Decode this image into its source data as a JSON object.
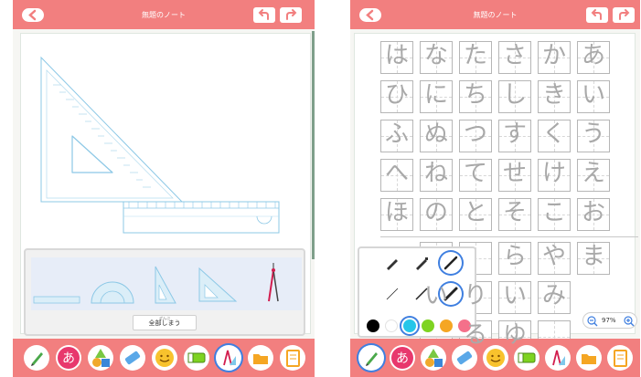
{
  "left_screen": {
    "header": {
      "title": "無題のノート"
    },
    "drawer": {
      "put_away_ruby": "ぜんぶ",
      "put_away_label": "全部しまう"
    }
  },
  "right_screen": {
    "header": {
      "title": "無題のノート"
    },
    "practice_sheet": {
      "rows_top": [
        [
          "は",
          "な",
          "た",
          "さ",
          "か",
          "あ"
        ],
        [
          "ひ",
          "に",
          "ち",
          "し",
          "き",
          "い"
        ],
        [
          "ふ",
          "ぬ",
          "つ",
          "す",
          "く",
          "う"
        ],
        [
          "へ",
          "ね",
          "て",
          "せ",
          "け",
          "え"
        ],
        [
          "ほ",
          "の",
          "と",
          "そ",
          "こ",
          "お"
        ]
      ],
      "rows_bottom": [
        [
          "",
          "",
          "ら",
          "や",
          "ま"
        ],
        [
          "い",
          "り",
          "い",
          "み"
        ],
        [
          "",
          "る",
          "ゆ",
          ""
        ]
      ]
    },
    "zoom": {
      "level": "97%"
    }
  },
  "colors": {
    "accent": "#f27f7f",
    "selection": "#3f7fe0",
    "swatches": [
      "#000000",
      "#ffffff",
      "#26c6e9",
      "#7ed321",
      "#f5a623",
      "#f4708a"
    ]
  },
  "toolbar_icons": [
    "pencil-icon",
    "hiragana-a-icon",
    "shapes-icon",
    "eraser-icon",
    "smiley-icon",
    "green-marker-icon",
    "ruler-compass-icon",
    "folder-icon",
    "notebook-icon"
  ]
}
